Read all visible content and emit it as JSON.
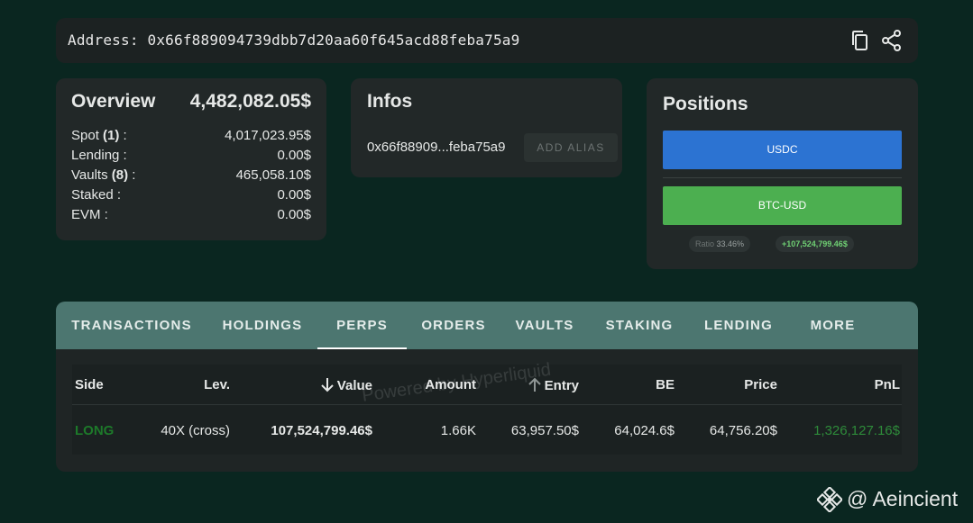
{
  "address_bar": {
    "text": "Address: 0x66f889094739dbb7d20aa60f645acd88feba75a9",
    "copy_icon": "copy-icon",
    "share_icon": "share-icon"
  },
  "overview": {
    "title": "Overview",
    "total": "4,482,082.05$",
    "rows": [
      {
        "label": "Spot",
        "count": "(1)",
        "suffix": " :",
        "value": "4,017,023.95$"
      },
      {
        "label": "Lending :",
        "count": "",
        "suffix": "",
        "value": "0.00$"
      },
      {
        "label": "Vaults",
        "count": "(8)",
        "suffix": " :",
        "value": "465,058.10$"
      },
      {
        "label": "Staked :",
        "count": "",
        "suffix": "",
        "value": "0.00$"
      },
      {
        "label": "EVM :",
        "count": "",
        "suffix": "",
        "value": "0.00$"
      }
    ]
  },
  "infos": {
    "title": "Infos",
    "short_address": "0x66f88909...feba75a9",
    "add_alias_label": "ADD ALIAS"
  },
  "positions": {
    "title": "Positions",
    "bars": [
      {
        "label": "USDC",
        "color": "#2c73d2"
      },
      {
        "label": "BTC-USD",
        "color": "#4caf50"
      }
    ],
    "ratio_label": "Ratio",
    "ratio_value": "33.46%",
    "pnl": "+107,524,799.46$"
  },
  "tabs": [
    {
      "label": "TRANSACTIONS",
      "active": false
    },
    {
      "label": "HOLDINGS",
      "active": false
    },
    {
      "label": "PERPS",
      "active": true
    },
    {
      "label": "ORDERS",
      "active": false
    },
    {
      "label": "VAULTS",
      "active": false
    },
    {
      "label": "STAKING",
      "active": false
    },
    {
      "label": "LENDING",
      "active": false
    },
    {
      "label": "MORE",
      "active": false
    }
  ],
  "table": {
    "headers": {
      "side": "Side",
      "lev": "Lev.",
      "value": "Value",
      "amount": "Amount",
      "entry": "Entry",
      "be": "BE",
      "price": "Price",
      "pnl": "PnL"
    },
    "rows": [
      {
        "side": "LONG",
        "lev": "40X (cross)",
        "value": "107,524,799.46$",
        "amount": "1.66K",
        "entry": "63,957.50$",
        "be": "64,024.6$",
        "price": "64,756.20$",
        "pnl": "1,326,127.16$"
      }
    ]
  },
  "watermark": "Powered by Hyperliquid",
  "brand": {
    "text": "@ Aeincient",
    "icon": "binance-logo-icon"
  },
  "colors": {
    "background": "#0a2620",
    "card": "#222828",
    "tab_bar": "#4c7670",
    "long": "#1d7a2a",
    "pnl_positive": "#6fcf73"
  }
}
